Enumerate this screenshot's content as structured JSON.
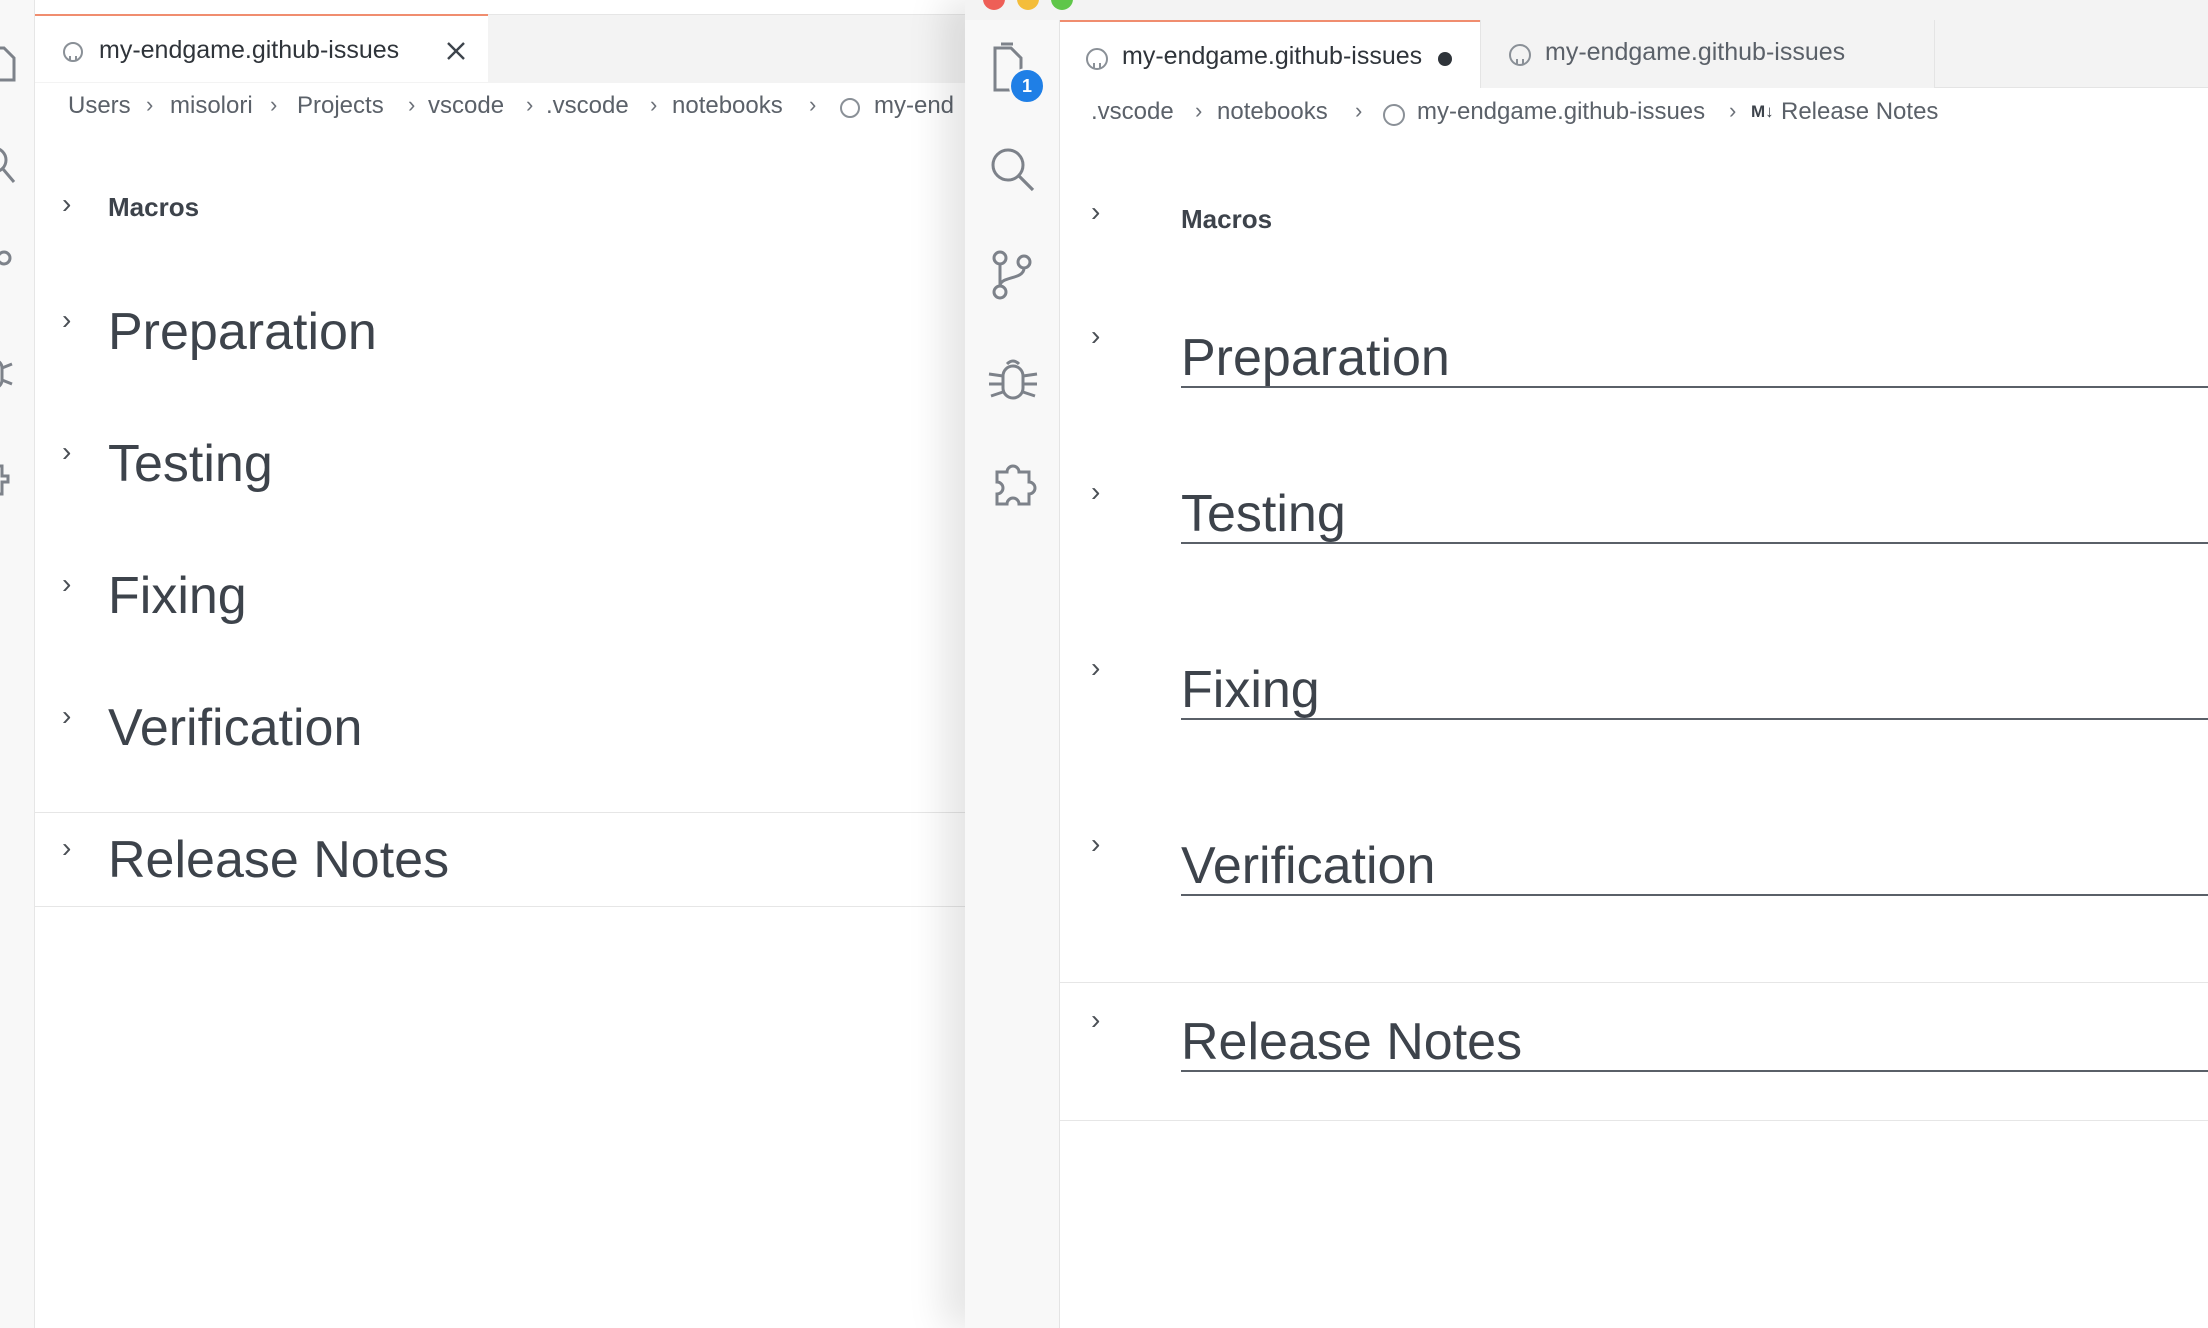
{
  "left": {
    "tab": {
      "label": "my-endgame.github-issues"
    },
    "breadcrumb": [
      "Users",
      "misolori",
      "Projects",
      "vscode",
      ".vscode",
      "notebooks",
      "my-end"
    ],
    "cells": [
      {
        "label": "Macros"
      },
      {
        "label": "Preparation"
      },
      {
        "label": "Testing"
      },
      {
        "label": "Fixing"
      },
      {
        "label": "Verification"
      },
      {
        "label": "Release Notes"
      }
    ]
  },
  "right": {
    "tabs": [
      {
        "label": "my-endgame.github-issues",
        "dirty": true
      },
      {
        "label": "my-endgame.github-issues",
        "dirty": false
      }
    ],
    "activity": {
      "explorer_badge": "1"
    },
    "breadcrumb": {
      "items": [
        ".vscode",
        "notebooks",
        "my-endgame.github-issues"
      ],
      "md_badge": "M↓",
      "current": "Release Notes"
    },
    "cells": [
      {
        "label": "Macros"
      },
      {
        "label": "Preparation"
      },
      {
        "label": "Testing"
      },
      {
        "label": "Fixing"
      },
      {
        "label": "Verification"
      },
      {
        "label": "Release Notes"
      }
    ]
  },
  "colors": {
    "accent_tab_border": "#f08d6f",
    "badge": "#1f7fe6",
    "text": "#3d434b",
    "tabstrip": "#f3f3f3"
  }
}
